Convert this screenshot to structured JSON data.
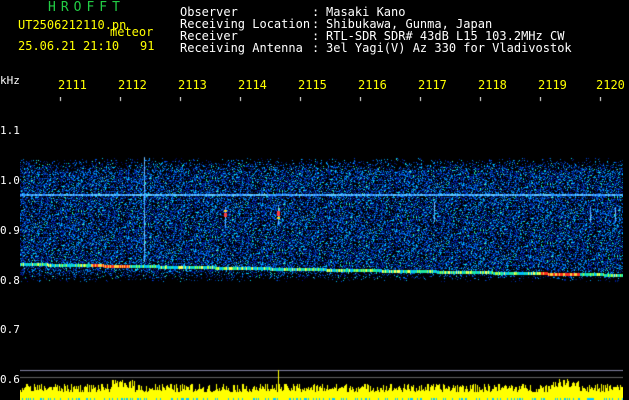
{
  "header": {
    "brand": "HROFFT",
    "file_name": "UT2506212110.pn",
    "file_type": "meteor",
    "datetime": "25.06.21 21:10",
    "extra": "91",
    "rows": [
      {
        "label": "Observer",
        "value": "Masaki Kano"
      },
      {
        "label": "Receiving Location",
        "value": "Shibukawa, Gunma, Japan"
      },
      {
        "label": "Receiver",
        "value": "RTL-SDR SDR# 43dB L15 103.2MHz CW"
      },
      {
        "label": "Receiving Antenna",
        "value": "3el Yagi(V) Az 330 for Vladivostok"
      }
    ]
  },
  "axis": {
    "unit": "kHz",
    "y_ticks": [
      "1.1",
      "1.0",
      "0.9",
      "0.8",
      "0.7",
      "0.6"
    ],
    "x_ticks": [
      "2111",
      "2112",
      "2113",
      "2114",
      "2115",
      "2116",
      "2117",
      "2118",
      "2119",
      "2120"
    ]
  },
  "colors": {
    "header_text": "#ffffff",
    "accent_yellow": "#ffff00",
    "brand_green": "#22cc44",
    "background": "#000000",
    "spectrum_low": "#001080",
    "spectrum_high": "#ff2020"
  }
}
